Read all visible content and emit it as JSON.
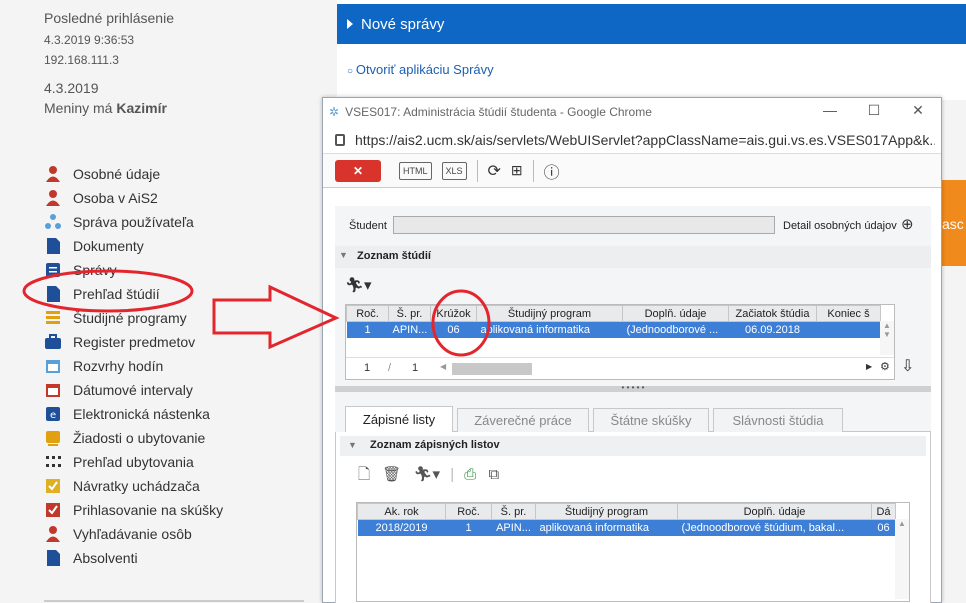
{
  "sidebar": {
    "last_login_label": "Posledné prihlásenie",
    "last_login_time": "4.3.2019 9:36:53",
    "last_login_ip": "192.168.111.3",
    "date": "4.3.2019",
    "nameday_prefix": "Meniny má ",
    "nameday_name": "Kazimír",
    "items": [
      {
        "label": "Osobné údaje",
        "icon": "person-icon",
        "color": "#c0392b"
      },
      {
        "label": "Osoba v AiS2",
        "icon": "person-icon",
        "color": "#c0392b"
      },
      {
        "label": "Správa používateľa",
        "icon": "org-chart-icon",
        "color": "#5aa0d8"
      },
      {
        "label": "Dokumenty",
        "icon": "document-icon",
        "color": "#1f4f99"
      },
      {
        "label": "Správy",
        "icon": "messages-icon",
        "color": "#1f4f99"
      },
      {
        "label": "Prehľad štúdií",
        "icon": "document-icon",
        "color": "#1f4f99"
      },
      {
        "label": "Študijné programy",
        "icon": "list-icon",
        "color": "#e0a010"
      },
      {
        "label": "Register predmetov",
        "icon": "briefcase-icon",
        "color": "#1f4f99"
      },
      {
        "label": "Rozvrhy hodín",
        "icon": "calendar-icon",
        "color": "#5aa0d8"
      },
      {
        "label": "Dátumové intervaly",
        "icon": "calendar-icon",
        "color": "#c0392b"
      },
      {
        "label": "Elektronická nástenka",
        "icon": "board-icon",
        "color": "#1f4f99"
      },
      {
        "label": "Žiadosti o ubytovanie",
        "icon": "request-icon",
        "color": "#e0a010"
      },
      {
        "label": "Prehľad ubytovania",
        "icon": "grid-dots-icon",
        "color": "#333333"
      },
      {
        "label": "Návratky uchádzača",
        "icon": "checkbox-icon",
        "color": "#e0b020"
      },
      {
        "label": "Prihlasovanie na skúšky",
        "icon": "checkbox-icon",
        "color": "#c0392b"
      },
      {
        "label": "Vyhľadávanie osôb",
        "icon": "person-search-icon",
        "color": "#c0392b"
      },
      {
        "label": "Absolventi",
        "icon": "document-icon",
        "color": "#1f4f99"
      }
    ]
  },
  "top_panel": {
    "news_title": "Nové správy",
    "open_messages_link": "Otvoriť aplikáciu Správy",
    "orange_fragment": "asc"
  },
  "popup": {
    "window_title": "VSES017: Administrácia štúdií študenta - Google Chrome",
    "url": "https://ais2.ucm.sk/ais/servlets/WebUIServlet?appClassName=ais.gui.vs.es.VSES017App&k...",
    "toolbar": {
      "close_label": "✕",
      "html_label": "HTML",
      "xls_label": "XLS"
    },
    "student_label": "Študent",
    "personal_detail_link": "Detail osobných údajov",
    "studies_section": "Zoznam štúdií",
    "studies_table": {
      "columns": [
        "Roč.",
        "Š. pr.",
        "Krúžok",
        "Študijný program",
        "Doplň. údaje",
        "Začiatok štúdia",
        "Koniec š"
      ],
      "rows": [
        [
          "1",
          "APIN...",
          "06",
          "aplikovaná informatika",
          "(Jednoodborové ...",
          "06.09.2018",
          ""
        ]
      ]
    },
    "pager": {
      "page": "1",
      "sep": "/",
      "total": "1"
    },
    "tabs": [
      "Zápisné listy",
      "Záverečné práce",
      "Štátne skúšky",
      "Slávnosti štúdia"
    ],
    "enrollment_section": "Zoznam zápisných listov",
    "enrollment_table": {
      "columns": [
        "Ak. rok",
        "Roč.",
        "Š. pr.",
        "Študijný program",
        "Doplň. údaje",
        "Dá"
      ],
      "rows": [
        [
          "2018/2019",
          "1",
          "APIN...",
          "aplikovaná informatika",
          "(Jednoodborové štúdium, bakal...",
          "06"
        ]
      ]
    }
  },
  "colors": {
    "accent_blue": "#0e66c5",
    "selected_row": "#3d7fd6",
    "annotation_red": "#e3262d",
    "close_red": "#d9342b"
  }
}
